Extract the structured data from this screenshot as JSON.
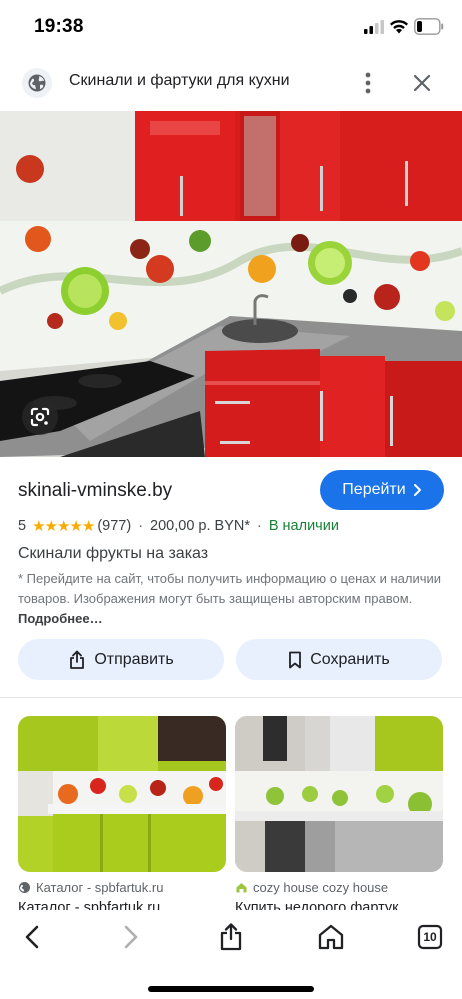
{
  "status_bar": {
    "time": "19:38",
    "battery_level": 0.2,
    "icons": [
      "signal-icon",
      "wifi-icon",
      "battery-icon"
    ]
  },
  "header": {
    "title": "Скинали и фартуки для кухни",
    "icons": [
      "globe-icon",
      "more-vertical-icon",
      "close-icon"
    ]
  },
  "hero": {
    "lens_icon": "google-lens-icon"
  },
  "listing": {
    "site": "skinali-vminske.by",
    "goto_label": "Перейти",
    "rating": "5",
    "rating_value": 5,
    "review_count": "(977)",
    "price": "200,00 р. BYN*",
    "availability": "В наличии",
    "product_title": "Скинали фрукты на заказ",
    "disclaimer": "* Перейдите на сайт, чтобы получить информацию о ценах и наличии товаров. Изображения могут быть защищены авторским правом.",
    "more_link": "Подробнее…",
    "share_label": "Отправить",
    "save_label": "Сохранить"
  },
  "related": [
    {
      "source": "Каталог - spbfartuk.ru",
      "title": "Каталог - spbfartuk.ru"
    },
    {
      "source": "cozy house cozy house",
      "title": "Купить недорого фартук"
    }
  ],
  "bottom_nav": {
    "tab_count": "10",
    "icons": [
      "back-icon",
      "forward-icon",
      "share-icon",
      "home-icon",
      "tabs-icon"
    ]
  },
  "colors": {
    "accent": "#1a73e8",
    "stars": "#f9ab00",
    "in_stock": "#188038",
    "button_tint": "#e8f0fe"
  }
}
